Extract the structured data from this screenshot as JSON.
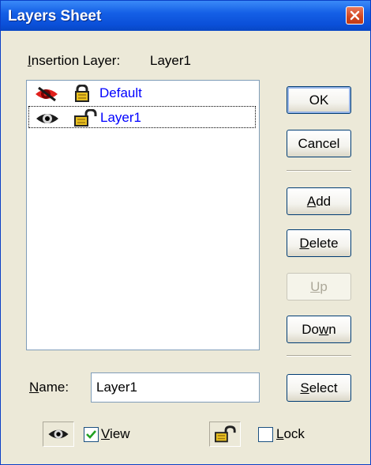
{
  "window": {
    "title": "Layers Sheet",
    "close_glyph": "×"
  },
  "insertion": {
    "label": "Insertion Layer:",
    "label_mnemonic": "I",
    "label_rest": "nsertion Layer:",
    "value": "Layer1"
  },
  "layers": [
    {
      "name": "Default",
      "visible": false,
      "locked": true,
      "selected": false
    },
    {
      "name": "Layer1",
      "visible": true,
      "locked": false,
      "selected": true
    }
  ],
  "buttons": {
    "ok": "OK",
    "cancel": "Cancel",
    "add_mnemonic": "A",
    "add_rest": "dd",
    "delete_mnemonic": "D",
    "delete_rest": "elete",
    "up_mnemonic": "U",
    "up_rest": "p",
    "down_pre": "Do",
    "down_mnemonic": "w",
    "down_rest": "n",
    "select_mnemonic": "S",
    "select_rest": "elect"
  },
  "name_field": {
    "label_mnemonic": "N",
    "label_rest": "ame:",
    "value": "Layer1"
  },
  "view": {
    "label_mnemonic": "V",
    "label_rest": "iew",
    "checked": true
  },
  "lock": {
    "label_mnemonic": "L",
    "label_rest": "ock",
    "checked": false
  },
  "colors": {
    "title_bar": "#0a4fd8",
    "dialog_bg": "#ece9d8",
    "layer_text": "#0000ff",
    "hidden_eye": "#e0201c",
    "lock_gold": "#e8c020"
  },
  "icons": {
    "visibility": "eye-icon",
    "hidden": "eye-slash-icon",
    "locked": "lock-closed-icon",
    "unlocked": "lock-open-icon"
  }
}
